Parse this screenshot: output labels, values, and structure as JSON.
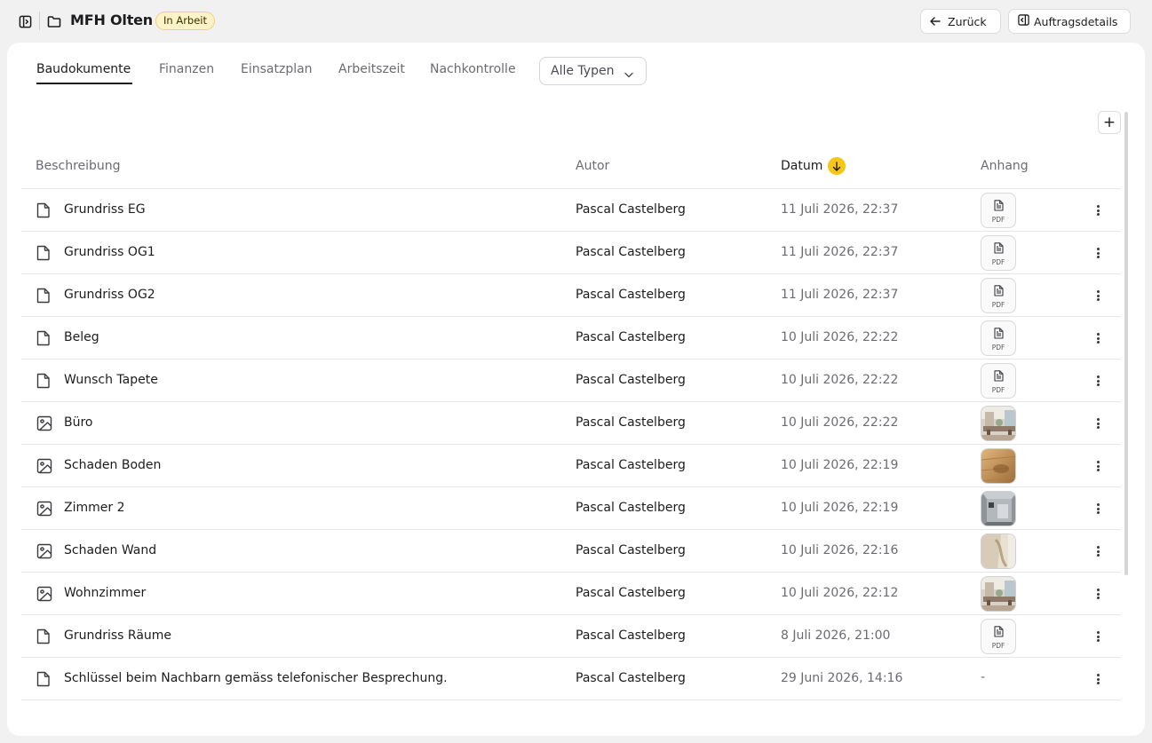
{
  "header": {
    "project_title": "MFH Olten",
    "status_badge": "In Arbeit",
    "back_label": "Zurück",
    "details_label": "Auftragsdetails"
  },
  "tabs": [
    {
      "label": "Baudokumente",
      "active": true
    },
    {
      "label": "Finanzen",
      "active": false
    },
    {
      "label": "Einsatzplan",
      "active": false
    },
    {
      "label": "Arbeitszeit",
      "active": false
    },
    {
      "label": "Nachkontrolle",
      "active": false
    }
  ],
  "filter": {
    "selected": "Alle Typen"
  },
  "add_button": "+",
  "columns": {
    "description": "Beschreibung",
    "author": "Autor",
    "date": "Datum",
    "attachment": "Anhang"
  },
  "rows": [
    {
      "type": "document",
      "description": "Grundriss EG",
      "author": "Pascal Castelberg",
      "date": "11 Juli 2026, 22:37",
      "attachment": "pdf",
      "pdf_label": "PDF"
    },
    {
      "type": "document",
      "description": "Grundriss OG1",
      "author": "Pascal Castelberg",
      "date": "11 Juli 2026, 22:37",
      "attachment": "pdf",
      "pdf_label": "PDF"
    },
    {
      "type": "document",
      "description": "Grundriss OG2",
      "author": "Pascal Castelberg",
      "date": "11 Juli 2026, 22:37",
      "attachment": "pdf",
      "pdf_label": "PDF"
    },
    {
      "type": "document",
      "description": "Beleg",
      "author": "Pascal Castelberg",
      "date": "10 Juli 2026, 22:22",
      "attachment": "pdf",
      "pdf_label": "PDF"
    },
    {
      "type": "document",
      "description": "Wunsch Tapete",
      "author": "Pascal Castelberg",
      "date": "10 Juli 2026, 22:22",
      "attachment": "pdf",
      "pdf_label": "PDF"
    },
    {
      "type": "image",
      "description": "Büro",
      "author": "Pascal Castelberg",
      "date": "10 Juli 2026, 22:22",
      "attachment": "image",
      "thumb": "office"
    },
    {
      "type": "image",
      "description": "Schaden Boden",
      "author": "Pascal Castelberg",
      "date": "10 Juli 2026, 22:19",
      "attachment": "image",
      "thumb": "floor"
    },
    {
      "type": "image",
      "description": "Zimmer 2",
      "author": "Pascal Castelberg",
      "date": "10 Juli 2026, 22:19",
      "attachment": "image",
      "thumb": "room"
    },
    {
      "type": "image",
      "description": "Schaden Wand",
      "author": "Pascal Castelberg",
      "date": "10 Juli 2026, 22:16",
      "attachment": "image",
      "thumb": "wall"
    },
    {
      "type": "image",
      "description": "Wohnzimmer",
      "author": "Pascal Castelberg",
      "date": "10 Juli 2026, 22:12",
      "attachment": "image",
      "thumb": "office"
    },
    {
      "type": "document",
      "description": "Grundriss Räume",
      "author": "Pascal Castelberg",
      "date": "8 Juli 2026, 21:00",
      "attachment": "pdf",
      "pdf_label": "PDF"
    },
    {
      "type": "document",
      "description": "Schlüssel beim Nachbarn gemäss telefonischer Besprechung.",
      "author": "Pascal Castelberg",
      "date": "29 Juni 2026, 14:16",
      "attachment": "none",
      "empty_label": "-"
    }
  ],
  "colors": {
    "accent": "#f5c518",
    "badge_bg": "#fdf3c8",
    "page_bg": "#f1f1f2"
  }
}
